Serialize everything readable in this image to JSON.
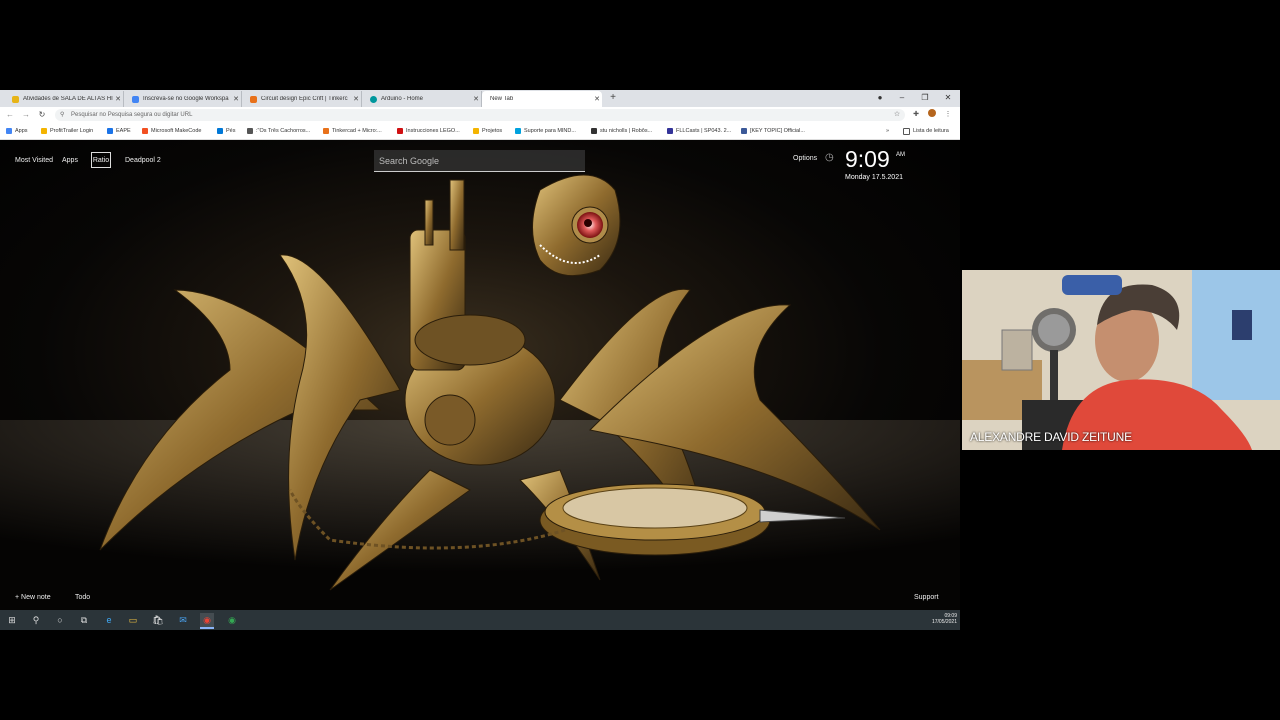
{
  "browser": {
    "tabs": [
      {
        "title": "Atividades de SALA DE ALTAS HI",
        "favicon_color": "#e7b417",
        "active": false
      },
      {
        "title": "Inscreva-se no Google Workspa",
        "favicon_color": "#4285f4",
        "active": false
      },
      {
        "title": "Circuit design Epic Crift | Tinkerc",
        "favicon_color": "#e8711a",
        "active": false
      },
      {
        "title": "Arduino - Home",
        "favicon_color": "#00979d",
        "active": false
      },
      {
        "title": "New Tab",
        "favicon_color": "#ffffff",
        "active": true
      }
    ],
    "new_tab_symbol": "+",
    "address_placeholder": "Pesquisar no Pesquisa segura ou digitar URL",
    "bookmarks": [
      {
        "label": "Apps",
        "color": "#4285f4"
      },
      {
        "label": "ProfitTrailer Login",
        "color": "#f4b400"
      },
      {
        "label": "EAPE",
        "color": "#1a73e8"
      },
      {
        "label": "Microsoft MakeCode",
        "color": "#f25022"
      },
      {
        "label": "Pés",
        "color": "#0078d7"
      },
      {
        "label": ":\"Os Três Cachorros...",
        "color": "#555555"
      },
      {
        "label": "Tinkercad + Micro:...",
        "color": "#e8711a"
      },
      {
        "label": "Instrucciones LEGO...",
        "color": "#d01012"
      },
      {
        "label": "Projetos",
        "color": "#f4b400"
      },
      {
        "label": "Suporte para MIND...",
        "color": "#00a1de"
      },
      {
        "label": "stu nicholls | Robôs...",
        "color": "#333333"
      },
      {
        "label": "FLLCasts | SP043. 2...",
        "color": "#333399"
      },
      {
        "label": "[KEY TOPIC] Official...",
        "color": "#3b5998"
      }
    ],
    "bookmarks_more": "»",
    "reading_list": "Lista de leitura"
  },
  "newtab": {
    "links": [
      "Most Visited",
      "Apps",
      "Ratio",
      "Deadpool 2"
    ],
    "search_placeholder": "Search Google",
    "options_label": "Options",
    "time": "9:09",
    "ampm": "AM",
    "date": "Monday  17.5.2021",
    "new_note": "+ New note",
    "todo": "Todo",
    "support": "Support"
  },
  "taskbar": {
    "icons": [
      "windows-start-icon",
      "search-icon",
      "cortana-icon",
      "task-view-icon",
      "edge-icon",
      "file-explorer-icon",
      "store-icon",
      "mail-icon",
      "chrome-icon",
      "chrome-alt-icon"
    ],
    "time": "09:09",
    "date": "17/05/2021"
  },
  "webcam": {
    "participant_name": "ALEXANDRE DAVID ZEITUNE"
  }
}
